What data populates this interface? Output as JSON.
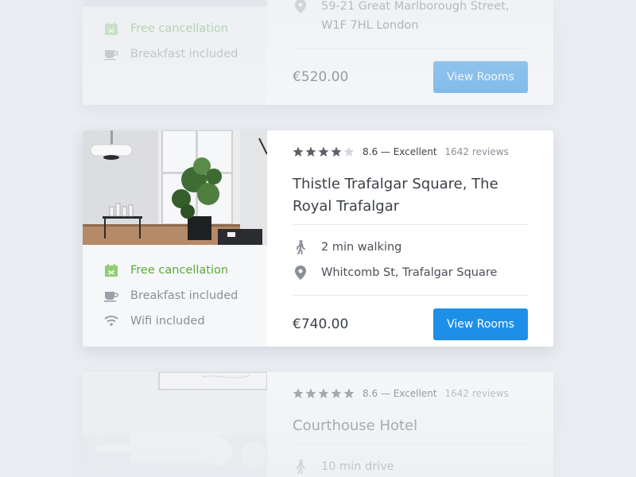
{
  "cards": [
    {
      "amenities": [
        {
          "label": "Free cancellation",
          "icon": "calendar-check-icon"
        },
        {
          "label": "Breakfast included",
          "icon": "coffee-cup-icon"
        }
      ],
      "address": "59-21 Great Marlborough Street, W1F 7HL London",
      "address_line1": "59-21 Great Marlborough Street,",
      "address_line2": "W1F 7HL London",
      "price": "€520.00",
      "button": "View Rooms"
    },
    {
      "stars": 4,
      "score": "8.6 — Excellent",
      "reviews": "1642 reviews",
      "title": "Thistle Trafalgar Square, The Royal Trafalgar",
      "walking": "2 min walking",
      "address": "Whitcomb St, Trafalgar Square",
      "amenities": [
        {
          "label": "Free cancellation",
          "icon": "calendar-check-icon"
        },
        {
          "label": "Breakfast included",
          "icon": "coffee-cup-icon"
        },
        {
          "label": "Wifi included",
          "icon": "wifi-icon"
        }
      ],
      "price": "€740.00",
      "button": "View Rooms"
    },
    {
      "stars": 5,
      "score": "8.6 — Excellent",
      "reviews": "1642 reviews",
      "title": "Courthouse Hotel",
      "travel": "10 min drive"
    }
  ],
  "colors": {
    "background": "#e9ecf1",
    "accent": "#1e8fe6",
    "green": "#5ba93c",
    "text": "#3b4048",
    "muted": "#8a8f98"
  }
}
